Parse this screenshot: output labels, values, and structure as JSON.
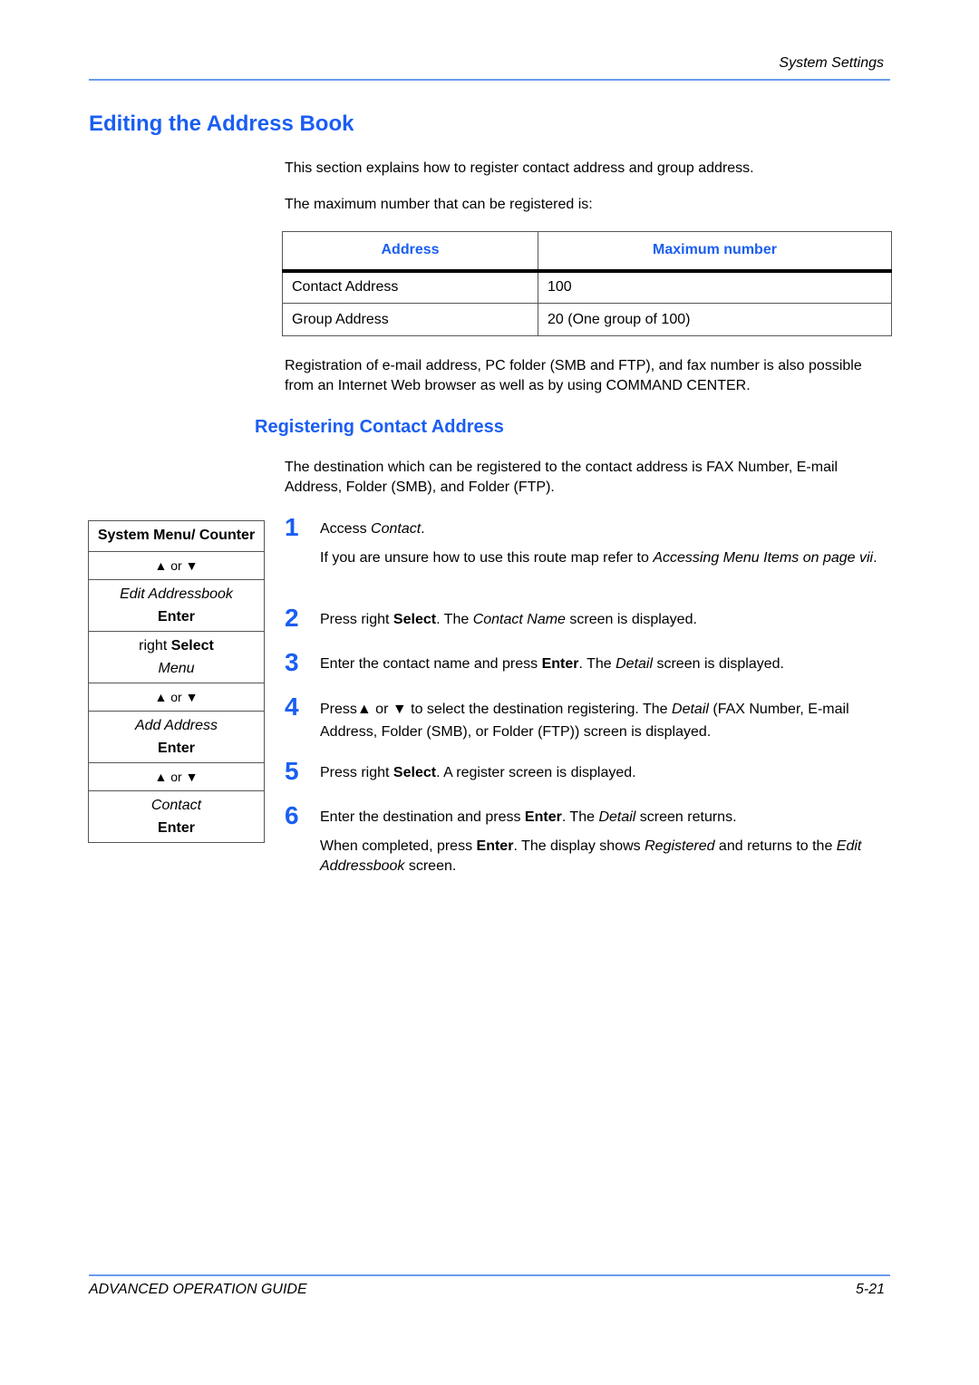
{
  "header": {
    "section_title": "System Settings"
  },
  "title": "Editing the Address Book",
  "intro": {
    "line1": "This section explains how to register contact address and group address.",
    "line2": "The maximum number that can be registered is:"
  },
  "table": {
    "headers": [
      "Address",
      "Maximum number"
    ],
    "rows": [
      [
        "Contact Address",
        "100"
      ],
      [
        "Group Address",
        "20 (One group of 100)"
      ]
    ]
  },
  "note": "Registration of e-mail address, PC folder (SMB and FTP), and fax number is also possible from an Internet Web browser as well as by using COMMAND CENTER.",
  "subsection": {
    "title": "Registering Contact Address",
    "description": "The destination which can be registered to the contact address is FAX Number, E-mail Address, Folder (SMB), and Folder (FTP)."
  },
  "route_map": {
    "start": "System Menu/ Counter",
    "arrows_label": "▲ or ▼",
    "edit_addressbook": "Edit Addressbook",
    "enter": "Enter",
    "right": "right",
    "select": "Select",
    "menu": "Menu",
    "add_address": "Add Address",
    "contact": "Contact"
  },
  "steps": [
    {
      "num": "1",
      "parts": {
        "a": "Access ",
        "b": "Contact",
        "c": "."
      },
      "sub": {
        "a": "If you are unsure how to use this route map refer to ",
        "b": "Accessing Menu Items on page vii",
        "c": "."
      }
    },
    {
      "num": "2",
      "parts": {
        "a": "Press right ",
        "b": "Select",
        "c": ". The ",
        "d": "Contact Name",
        "e": " screen is displayed."
      }
    },
    {
      "num": "3",
      "parts": {
        "a": "Enter the contact name and press ",
        "b": "Enter",
        "c": ". The ",
        "d": "Detail",
        "e": " screen is displayed."
      }
    },
    {
      "num": "4",
      "parts": {
        "a": "Press▲ or ▼ to select the destination registering. The ",
        "b": "Detail",
        "c": " (FAX Number, E-mail Address, Folder (SMB), or Folder (FTP)) screen is displayed."
      }
    },
    {
      "num": "5",
      "parts": {
        "a": "Press right ",
        "b": "Select",
        "c": ". A register screen is displayed."
      }
    },
    {
      "num": "6",
      "parts": {
        "a": "Enter the destination and press ",
        "b": "Enter",
        "c": ". The ",
        "d": "Detail",
        "e": " screen returns."
      },
      "sub": {
        "a": "When completed, press ",
        "b": "Enter",
        "c": ". The display shows ",
        "d": "Registered",
        "e": " and returns to the ",
        "f": "Edit Addressbook",
        "g": " screen."
      }
    }
  ],
  "footer": {
    "guide": "ADVANCED OPERATION GUIDE",
    "page": "5-21"
  },
  "colors": {
    "accent": "#1a5ef2",
    "rule": "#6a9cf0"
  }
}
